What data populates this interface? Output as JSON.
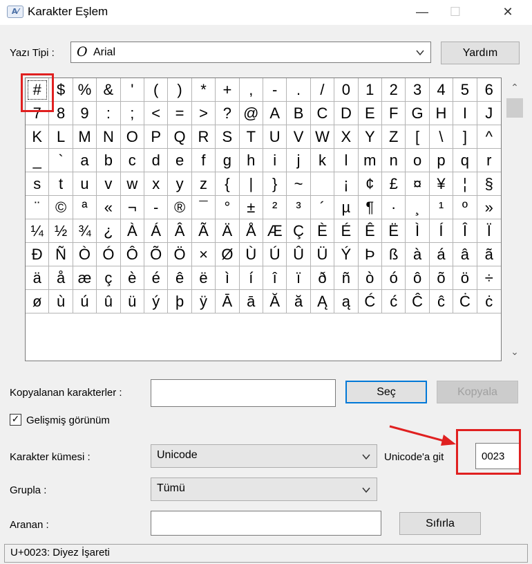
{
  "window": {
    "title": "Karakter Eşlem",
    "icon": "charmap-icon",
    "minimize_glyph": "—",
    "maximize_glyph": "☐",
    "close_glyph": "✕"
  },
  "font": {
    "label": "Yazı Tipi :",
    "value": "Arial",
    "font_icon_glyph": "O",
    "help_button": "Yardım"
  },
  "grid": {
    "selected_index": 0,
    "characters": [
      "#",
      "$",
      "%",
      "&",
      "'",
      "(",
      ")",
      "*",
      "+",
      ",",
      "-",
      ".",
      "/",
      "0",
      "1",
      "2",
      "3",
      "4",
      "5",
      "6",
      "7",
      "8",
      "9",
      ":",
      ";",
      "<",
      "=",
      ">",
      "?",
      "@",
      "A",
      "B",
      "C",
      "D",
      "E",
      "F",
      "G",
      "H",
      "I",
      "J",
      "K",
      "L",
      "M",
      "N",
      "O",
      "P",
      "Q",
      "R",
      "S",
      "T",
      "U",
      "V",
      "W",
      "X",
      "Y",
      "Z",
      "[",
      "\\",
      "]",
      "^",
      "_",
      "`",
      "a",
      "b",
      "c",
      "d",
      "e",
      "f",
      "g",
      "h",
      "i",
      "j",
      "k",
      "l",
      "m",
      "n",
      "o",
      "p",
      "q",
      "r",
      "s",
      "t",
      "u",
      "v",
      "w",
      "x",
      "y",
      "z",
      "{",
      "|",
      "}",
      "~",
      "",
      "¡",
      "¢",
      "£",
      "¤",
      "¥",
      "¦",
      "§",
      "¨",
      "©",
      "ª",
      "«",
      "¬",
      "-",
      "®",
      "¯",
      "°",
      "±",
      "²",
      "³",
      "´",
      "µ",
      "¶",
      "·",
      "¸",
      "¹",
      "º",
      "»",
      "¼",
      "½",
      "¾",
      "¿",
      "À",
      "Á",
      "Â",
      "Ã",
      "Ä",
      "Å",
      "Æ",
      "Ç",
      "È",
      "É",
      "Ê",
      "Ë",
      "Ì",
      "Í",
      "Î",
      "Ï",
      "Ð",
      "Ñ",
      "Ò",
      "Ó",
      "Ô",
      "Õ",
      "Ö",
      "×",
      "Ø",
      "Ù",
      "Ú",
      "Û",
      "Ü",
      "Ý",
      "Þ",
      "ß",
      "à",
      "á",
      "â",
      "ã",
      "ä",
      "å",
      "æ",
      "ç",
      "è",
      "é",
      "ê",
      "ë",
      "ì",
      "í",
      "î",
      "ï",
      "ð",
      "ñ",
      "ò",
      "ó",
      "ô",
      "õ",
      "ö",
      "÷",
      "ø",
      "ù",
      "ú",
      "û",
      "ü",
      "ý",
      "þ",
      "ÿ",
      "Ā",
      "ā",
      "Ă",
      "ă",
      "Ą",
      "ą",
      "Ć",
      "ć",
      "Ĉ",
      "ĉ",
      "Ċ",
      "ċ"
    ]
  },
  "scrollbar": {
    "up_glyph": "⌃",
    "down_glyph": "⌄"
  },
  "copy": {
    "label": "Kopyalanan karakterler :",
    "value": "",
    "select_button": "Seç",
    "copy_button": "Kopyala"
  },
  "advanced": {
    "label": "Gelişmiş görünüm",
    "checked": "✓"
  },
  "charset": {
    "label": "Karakter kümesi :",
    "value": "Unicode",
    "goto_label": "Unicode'a git",
    "goto_value": "0023"
  },
  "group": {
    "label": "Grupla :",
    "value": "Tümü"
  },
  "search": {
    "label": "Aranan :",
    "value": "",
    "reset_button": "Sıfırla"
  },
  "status": {
    "text": "U+0023: Diyez İşareti"
  },
  "colors": {
    "highlight": "#e02020",
    "focus": "#0078d7"
  }
}
